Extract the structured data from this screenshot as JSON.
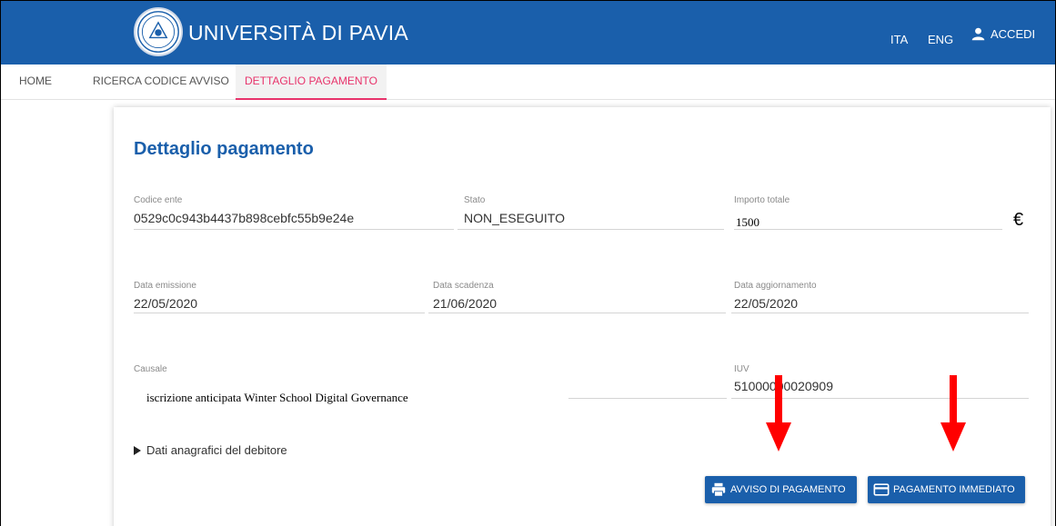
{
  "header": {
    "brand": "UNIVERSITÀ DI PAVIA",
    "logo_icon": "university-seal",
    "lang_ita": "ITA",
    "lang_eng": "ENG",
    "login_label": "ACCEDI",
    "login_icon": "user-icon",
    "bar_color": "#1a5fab"
  },
  "tabs": [
    {
      "label": "HOME"
    },
    {
      "label": "RICERCA CODICE AVVISO"
    },
    {
      "label": "DETTAGLIO PAGAMENTO",
      "active": true
    }
  ],
  "page": {
    "title": "Dettaglio pagamento",
    "fields": {
      "codice_ente": {
        "label": "Codice ente",
        "value": "0529c0c943b4437b898cebfc55b9e24e"
      },
      "stato": {
        "label": "Stato",
        "value": "NON_ESEGUITO"
      },
      "importo_totale": {
        "label": "Importo totale",
        "value": "1500",
        "currency": "€"
      },
      "data_emissione": {
        "label": "Data emissione",
        "value": "22/05/2020"
      },
      "data_scadenza": {
        "label": "Data scadenza",
        "value": "21/06/2020"
      },
      "data_aggiornamento": {
        "label": "Data aggiornamento",
        "value": "22/05/2020"
      },
      "causale": {
        "label": "Causale",
        "value": "iscrizione anticipata Winter School Digital Governance"
      },
      "iuv": {
        "label": "IUV",
        "value": "51000000020909"
      }
    },
    "dati_anagrafici": "Dati anagrafici del debitore"
  },
  "actions": {
    "avviso": {
      "label": "AVVISO DI PAGAMENTO",
      "icon": "printer-icon"
    },
    "pagamento": {
      "label": "PAGAMENTO IMMEDIATO",
      "icon": "credit-card-icon"
    }
  },
  "accent_color": "#e8336b",
  "annotation_color": "#ff0000"
}
